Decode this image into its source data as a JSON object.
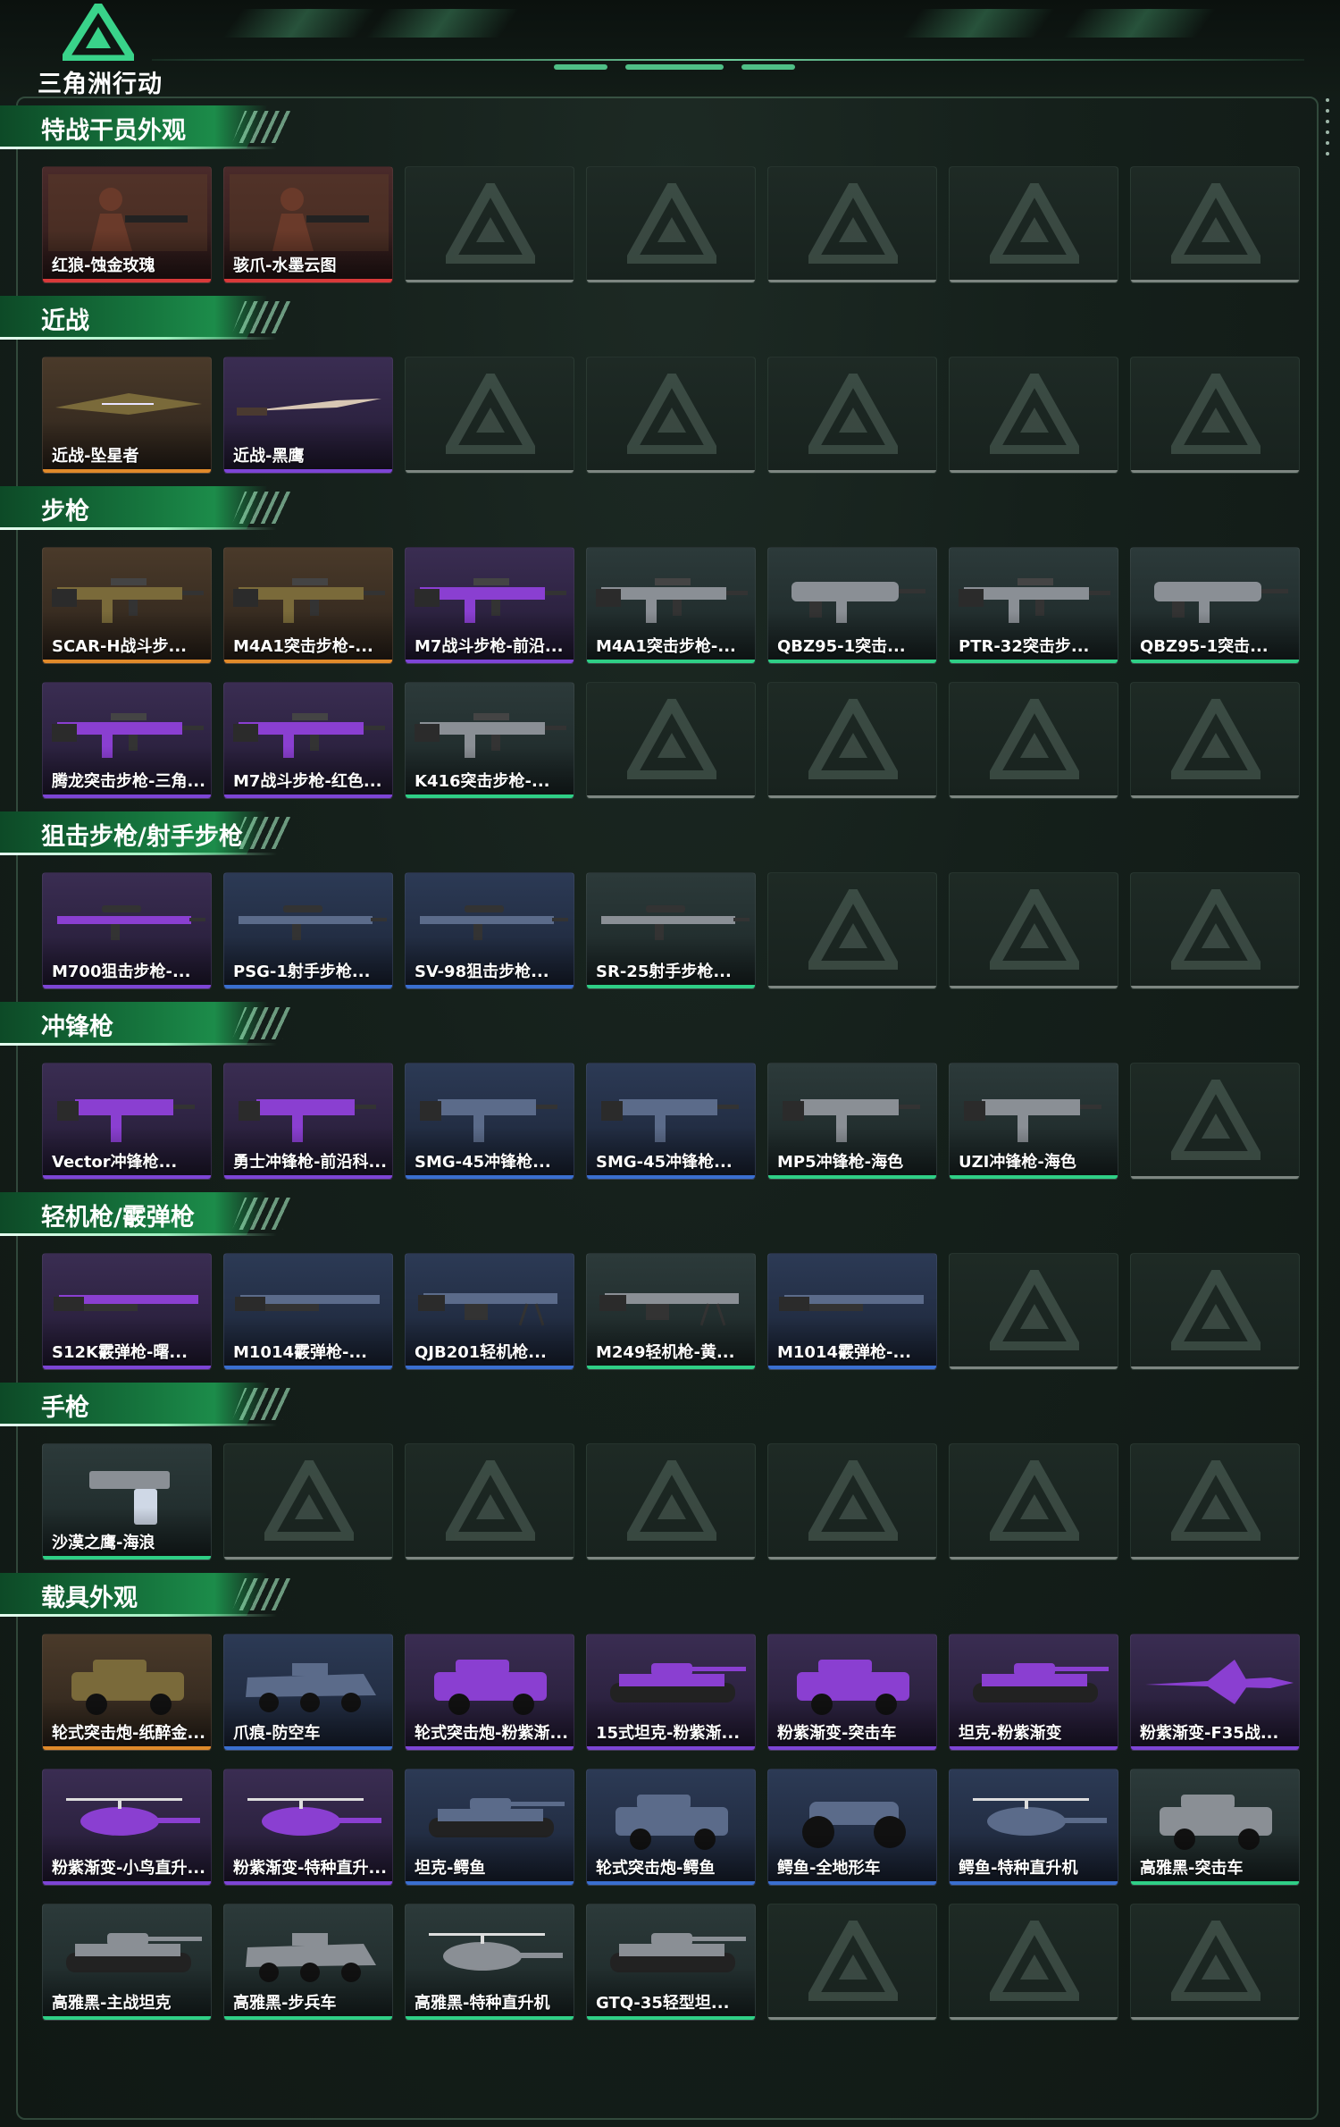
{
  "brand": {
    "name": "三角洲行动"
  },
  "colors": {
    "rarity_purple": "#7d45d6",
    "rarity_gold": "#e08a2a",
    "rarity_red": "#d93a3a",
    "rarity_blue": "#3a6fd0",
    "rarity_green": "#2fcf86",
    "empty_slot": "#7d8681"
  },
  "sections": [
    {
      "title": "特战干员外观",
      "slots": 7,
      "items": [
        {
          "label": "红狼-蚀金玫瑰",
          "rarity": "red",
          "art": "operator"
        },
        {
          "label": "骇爪-水墨云图",
          "rarity": "red",
          "art": "operator"
        }
      ]
    },
    {
      "title": "近战",
      "slots": 7,
      "items": [
        {
          "label": "近战-坠星者",
          "rarity": "gold",
          "art": "blade"
        },
        {
          "label": "近战-黑鹰",
          "rarity": "purple",
          "art": "knife"
        }
      ]
    },
    {
      "title": "步枪",
      "slots": 14,
      "items": [
        {
          "label": "SCAR-H战斗步...",
          "rarity": "gold",
          "art": "rifle"
        },
        {
          "label": "M4A1突击步枪-...",
          "rarity": "gold",
          "art": "rifle"
        },
        {
          "label": "M7战斗步枪-前沿...",
          "rarity": "purple",
          "art": "rifle"
        },
        {
          "label": "M4A1突击步枪-...",
          "rarity": "green",
          "art": "rifle"
        },
        {
          "label": "QBZ95-1突击...",
          "rarity": "green",
          "art": "bullpup"
        },
        {
          "label": "PTR-32突击步...",
          "rarity": "green",
          "art": "rifle"
        },
        {
          "label": "QBZ95-1突击...",
          "rarity": "green",
          "art": "bullpup"
        },
        {
          "label": "腾龙突击步枪-三角...",
          "rarity": "purple",
          "art": "rifle"
        },
        {
          "label": "M7战斗步枪-红色...",
          "rarity": "purple",
          "art": "rifle"
        },
        {
          "label": "K416突击步枪-...",
          "rarity": "green",
          "art": "rifle"
        }
      ]
    },
    {
      "title": "狙击步枪/射手步枪",
      "slots": 7,
      "items": [
        {
          "label": "M700狙击步枪-...",
          "rarity": "purple",
          "art": "sniper"
        },
        {
          "label": "PSG-1射手步枪...",
          "rarity": "blue",
          "art": "sniper"
        },
        {
          "label": "SV-98狙击步枪...",
          "rarity": "blue",
          "art": "sniper"
        },
        {
          "label": "SR-25射手步枪...",
          "rarity": "green",
          "art": "sniper"
        }
      ]
    },
    {
      "title": "冲锋枪",
      "slots": 7,
      "items": [
        {
          "label": "Vector冲锋枪...",
          "rarity": "purple",
          "art": "smg"
        },
        {
          "label": "勇士冲锋枪-前沿科...",
          "rarity": "purple",
          "art": "smg"
        },
        {
          "label": "SMG-45冲锋枪...",
          "rarity": "blue",
          "art": "smg"
        },
        {
          "label": "SMG-45冲锋枪...",
          "rarity": "blue",
          "art": "smg"
        },
        {
          "label": "MP5冲锋枪-海色",
          "rarity": "green",
          "art": "smg"
        },
        {
          "label": "UZI冲锋枪-海色",
          "rarity": "green",
          "art": "smg"
        }
      ]
    },
    {
      "title": "轻机枪/霰弹枪",
      "slots": 7,
      "items": [
        {
          "label": "S12K霰弹枪-曙...",
          "rarity": "purple",
          "art": "shotgun"
        },
        {
          "label": "M1014霰弹枪-...",
          "rarity": "blue",
          "art": "shotgun"
        },
        {
          "label": "QJB201轻机枪...",
          "rarity": "blue",
          "art": "lmg"
        },
        {
          "label": "M249轻机枪-黄...",
          "rarity": "green",
          "art": "lmg"
        },
        {
          "label": "M1014霰弹枪-...",
          "rarity": "blue",
          "art": "shotgun"
        }
      ]
    },
    {
      "title": "手枪",
      "slots": 7,
      "items": [
        {
          "label": "沙漠之鹰-海浪",
          "rarity": "green",
          "art": "pistol"
        }
      ]
    },
    {
      "title": "载具外观",
      "slots": 21,
      "items": [
        {
          "label": "轮式突击炮-纸醉金...",
          "rarity": "gold",
          "art": "truck"
        },
        {
          "label": "爪痕-防空车",
          "rarity": "blue",
          "art": "apc"
        },
        {
          "label": "轮式突击炮-粉紫渐...",
          "rarity": "purple",
          "art": "truck"
        },
        {
          "label": "15式坦克-粉紫渐...",
          "rarity": "purple",
          "art": "tank"
        },
        {
          "label": "粉紫渐变-突击车",
          "rarity": "purple",
          "art": "truck"
        },
        {
          "label": "坦克-粉紫渐变",
          "rarity": "purple",
          "art": "tank"
        },
        {
          "label": "粉紫渐变-F35战...",
          "rarity": "purple",
          "art": "jet"
        },
        {
          "label": "粉紫渐变-小鸟直升...",
          "rarity": "purple",
          "art": "heli"
        },
        {
          "label": "粉紫渐变-特种直升...",
          "rarity": "purple",
          "art": "heli"
        },
        {
          "label": "坦克-鳄鱼",
          "rarity": "blue",
          "art": "tank"
        },
        {
          "label": "轮式突击炮-鳄鱼",
          "rarity": "blue",
          "art": "truck"
        },
        {
          "label": "鳄鱼-全地形车",
          "rarity": "blue",
          "art": "atv"
        },
        {
          "label": "鳄鱼-特种直升机",
          "rarity": "blue",
          "art": "heli"
        },
        {
          "label": "高雅黑-突击车",
          "rarity": "green",
          "art": "truck"
        },
        {
          "label": "高雅黑-主战坦克",
          "rarity": "green",
          "art": "tank"
        },
        {
          "label": "高雅黑-步兵车",
          "rarity": "green",
          "art": "apc"
        },
        {
          "label": "高雅黑-特种直升机",
          "rarity": "green",
          "art": "heli"
        },
        {
          "label": "GTQ-35轻型坦...",
          "rarity": "green",
          "art": "tank"
        }
      ]
    }
  ]
}
